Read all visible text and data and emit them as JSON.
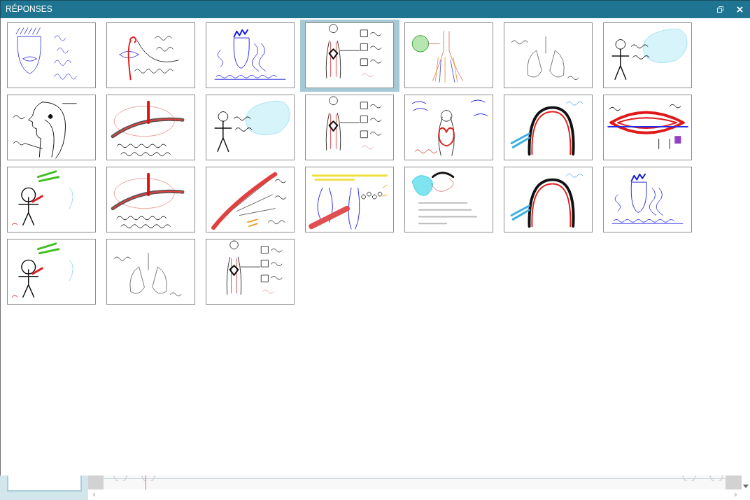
{
  "window": {
    "title": "RÉPONSES"
  },
  "answers": [
    {
      "selected": false
    },
    {
      "selected": false
    },
    {
      "selected": false
    },
    {
      "selected": true
    },
    {
      "selected": false
    },
    {
      "selected": false
    },
    {
      "selected": false
    },
    {
      "selected": false
    },
    {
      "selected": false
    },
    {
      "selected": false
    },
    {
      "selected": false
    },
    {
      "selected": false
    },
    {
      "selected": false
    },
    {
      "selected": false
    },
    {
      "selected": false
    },
    {
      "selected": false
    },
    {
      "selected": false
    },
    {
      "selected": false
    },
    {
      "selected": false
    },
    {
      "selected": false
    },
    {
      "selected": false
    },
    {
      "selected": false
    },
    {
      "selected": false
    },
    {
      "selected": false
    }
  ]
}
